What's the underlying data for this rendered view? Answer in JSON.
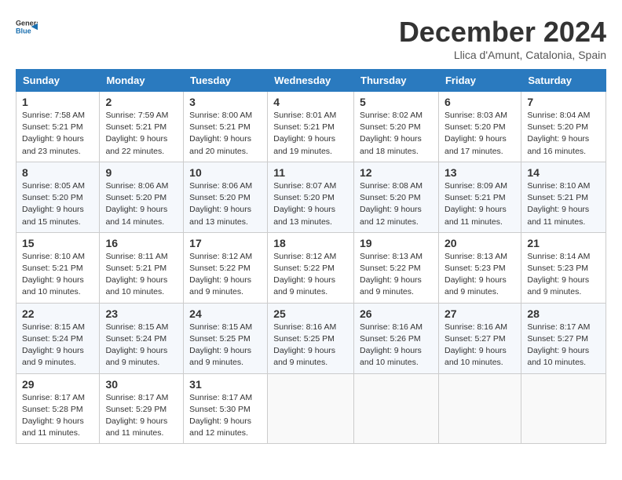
{
  "logo": {
    "general": "General",
    "blue": "Blue"
  },
  "header": {
    "month": "December 2024",
    "location": "Llica d'Amunt, Catalonia, Spain"
  },
  "weekdays": [
    "Sunday",
    "Monday",
    "Tuesday",
    "Wednesday",
    "Thursday",
    "Friday",
    "Saturday"
  ],
  "weeks": [
    [
      {
        "day": "1",
        "sunrise": "7:58 AM",
        "sunset": "5:21 PM",
        "daylight": "9 hours and 23 minutes."
      },
      {
        "day": "2",
        "sunrise": "7:59 AM",
        "sunset": "5:21 PM",
        "daylight": "9 hours and 22 minutes."
      },
      {
        "day": "3",
        "sunrise": "8:00 AM",
        "sunset": "5:21 PM",
        "daylight": "9 hours and 20 minutes."
      },
      {
        "day": "4",
        "sunrise": "8:01 AM",
        "sunset": "5:21 PM",
        "daylight": "9 hours and 19 minutes."
      },
      {
        "day": "5",
        "sunrise": "8:02 AM",
        "sunset": "5:20 PM",
        "daylight": "9 hours and 18 minutes."
      },
      {
        "day": "6",
        "sunrise": "8:03 AM",
        "sunset": "5:20 PM",
        "daylight": "9 hours and 17 minutes."
      },
      {
        "day": "7",
        "sunrise": "8:04 AM",
        "sunset": "5:20 PM",
        "daylight": "9 hours and 16 minutes."
      }
    ],
    [
      {
        "day": "8",
        "sunrise": "8:05 AM",
        "sunset": "5:20 PM",
        "daylight": "9 hours and 15 minutes."
      },
      {
        "day": "9",
        "sunrise": "8:06 AM",
        "sunset": "5:20 PM",
        "daylight": "9 hours and 14 minutes."
      },
      {
        "day": "10",
        "sunrise": "8:06 AM",
        "sunset": "5:20 PM",
        "daylight": "9 hours and 13 minutes."
      },
      {
        "day": "11",
        "sunrise": "8:07 AM",
        "sunset": "5:20 PM",
        "daylight": "9 hours and 13 minutes."
      },
      {
        "day": "12",
        "sunrise": "8:08 AM",
        "sunset": "5:20 PM",
        "daylight": "9 hours and 12 minutes."
      },
      {
        "day": "13",
        "sunrise": "8:09 AM",
        "sunset": "5:21 PM",
        "daylight": "9 hours and 11 minutes."
      },
      {
        "day": "14",
        "sunrise": "8:10 AM",
        "sunset": "5:21 PM",
        "daylight": "9 hours and 11 minutes."
      }
    ],
    [
      {
        "day": "15",
        "sunrise": "8:10 AM",
        "sunset": "5:21 PM",
        "daylight": "9 hours and 10 minutes."
      },
      {
        "day": "16",
        "sunrise": "8:11 AM",
        "sunset": "5:21 PM",
        "daylight": "9 hours and 10 minutes."
      },
      {
        "day": "17",
        "sunrise": "8:12 AM",
        "sunset": "5:22 PM",
        "daylight": "9 hours and 9 minutes."
      },
      {
        "day": "18",
        "sunrise": "8:12 AM",
        "sunset": "5:22 PM",
        "daylight": "9 hours and 9 minutes."
      },
      {
        "day": "19",
        "sunrise": "8:13 AM",
        "sunset": "5:22 PM",
        "daylight": "9 hours and 9 minutes."
      },
      {
        "day": "20",
        "sunrise": "8:13 AM",
        "sunset": "5:23 PM",
        "daylight": "9 hours and 9 minutes."
      },
      {
        "day": "21",
        "sunrise": "8:14 AM",
        "sunset": "5:23 PM",
        "daylight": "9 hours and 9 minutes."
      }
    ],
    [
      {
        "day": "22",
        "sunrise": "8:15 AM",
        "sunset": "5:24 PM",
        "daylight": "9 hours and 9 minutes."
      },
      {
        "day": "23",
        "sunrise": "8:15 AM",
        "sunset": "5:24 PM",
        "daylight": "9 hours and 9 minutes."
      },
      {
        "day": "24",
        "sunrise": "8:15 AM",
        "sunset": "5:25 PM",
        "daylight": "9 hours and 9 minutes."
      },
      {
        "day": "25",
        "sunrise": "8:16 AM",
        "sunset": "5:25 PM",
        "daylight": "9 hours and 9 minutes."
      },
      {
        "day": "26",
        "sunrise": "8:16 AM",
        "sunset": "5:26 PM",
        "daylight": "9 hours and 10 minutes."
      },
      {
        "day": "27",
        "sunrise": "8:16 AM",
        "sunset": "5:27 PM",
        "daylight": "9 hours and 10 minutes."
      },
      {
        "day": "28",
        "sunrise": "8:17 AM",
        "sunset": "5:27 PM",
        "daylight": "9 hours and 10 minutes."
      }
    ],
    [
      {
        "day": "29",
        "sunrise": "8:17 AM",
        "sunset": "5:28 PM",
        "daylight": "9 hours and 11 minutes."
      },
      {
        "day": "30",
        "sunrise": "8:17 AM",
        "sunset": "5:29 PM",
        "daylight": "9 hours and 11 minutes."
      },
      {
        "day": "31",
        "sunrise": "8:17 AM",
        "sunset": "5:30 PM",
        "daylight": "9 hours and 12 minutes."
      },
      null,
      null,
      null,
      null
    ]
  ],
  "labels": {
    "sunrise": "Sunrise:",
    "sunset": "Sunset:",
    "daylight": "Daylight:"
  }
}
